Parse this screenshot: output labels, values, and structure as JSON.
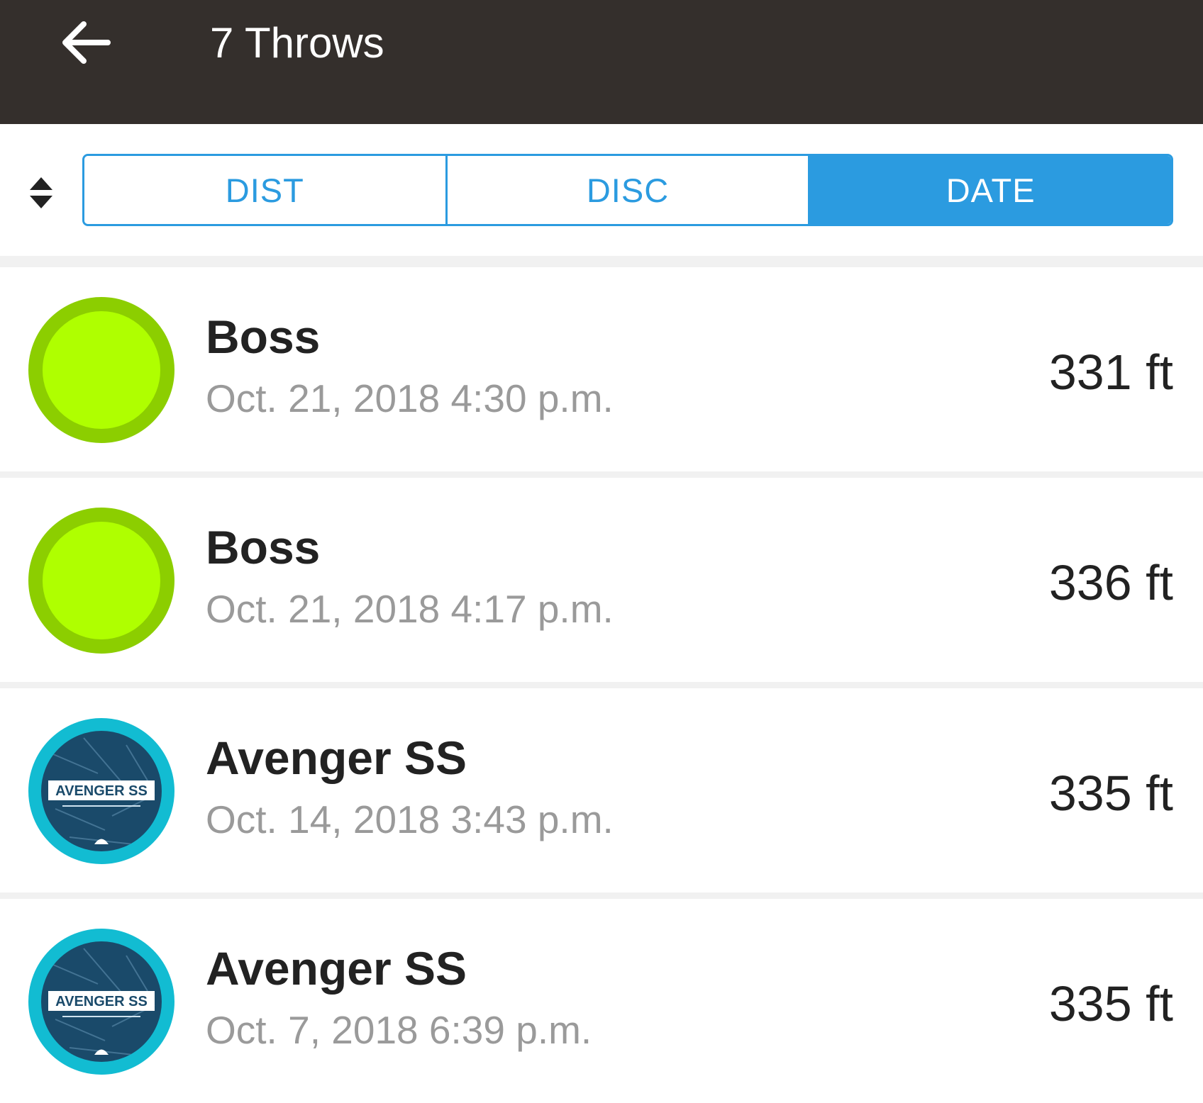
{
  "appbar": {
    "title": "7 Throws",
    "back_icon": "arrow-left-icon",
    "background": "#342f2c"
  },
  "sort": {
    "toggle_icon": "sort-updown-icon",
    "tabs": [
      {
        "label": "DIST",
        "active": false
      },
      {
        "label": "DISC",
        "active": false
      },
      {
        "label": "DATE",
        "active": true
      }
    ],
    "accent": "#2b9be0"
  },
  "throws": [
    {
      "disc": "Boss",
      "date": "Oct. 21, 2018 4:30 p.m.",
      "distance": "331 ft",
      "disc_style": "boss"
    },
    {
      "disc": "Boss",
      "date": "Oct. 21, 2018 4:17 p.m.",
      "distance": "336 ft",
      "disc_style": "boss"
    },
    {
      "disc": "Avenger SS",
      "date": "Oct. 14, 2018 3:43 p.m.",
      "distance": "335 ft",
      "disc_style": "avenger"
    },
    {
      "disc": "Avenger SS",
      "date": "Oct. 7, 2018 6:39 p.m.",
      "distance": "335 ft",
      "disc_style": "avenger"
    }
  ],
  "disc_art": {
    "avenger_logo_text": "AVENGER SS"
  },
  "colors": {
    "boss_fill": "#afff00",
    "boss_rim": "#8cce00",
    "avenger_rim": "#12bcd2",
    "avenger_fill": "#1a4a6a"
  }
}
